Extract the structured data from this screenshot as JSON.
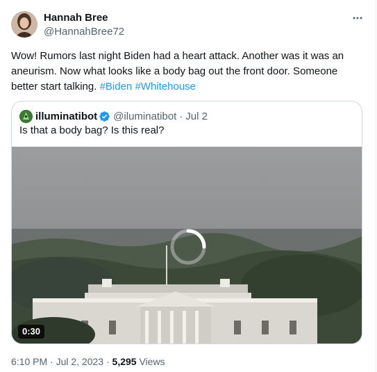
{
  "author": {
    "name": "Hannah Bree",
    "handle": "@HannahBree72",
    "avatar_icon": "profile-photo"
  },
  "more_icon": "more-horizontal-icon",
  "tweet": {
    "text": "Wow! Rumors last night Biden had a heart attack. Another was it was an aneurism. Now what looks like a body bag out the front door. Someone better start talking. ",
    "hashtags": [
      "#Biden",
      "#Whitehouse"
    ]
  },
  "quoted": {
    "name": "illuminatibot",
    "handle": "@iluminatibot",
    "separator": "·",
    "date": "Jul 2",
    "text": "Is that a body bag? Is this real?",
    "verified_icon": "verified-badge-icon",
    "accent_color": "#1d9bf0"
  },
  "video": {
    "duration": "0:30",
    "loading_icon": "loading-spinner-icon"
  },
  "meta": {
    "timestamp": "6:10 PM · Jul 2, 2023 · ",
    "views_count": "5,295",
    "views_label": " Views"
  }
}
